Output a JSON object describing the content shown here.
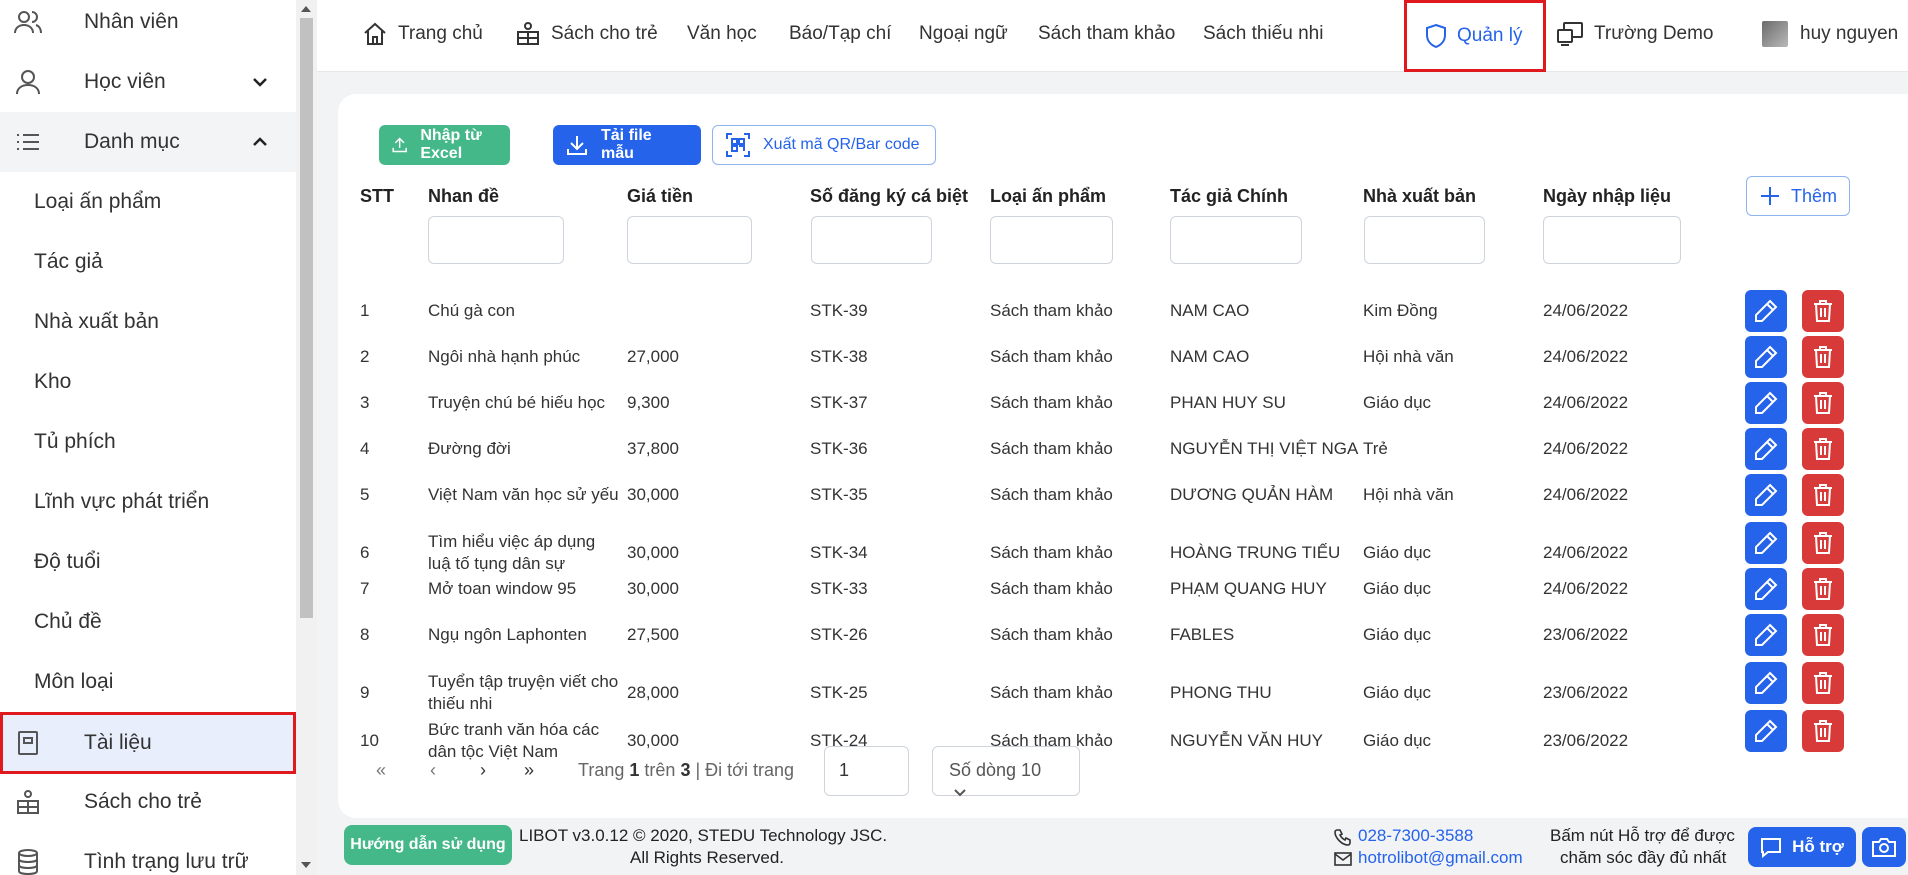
{
  "sidebar": {
    "items": [
      {
        "label": "Nhân viên",
        "icon": "users-icon"
      },
      {
        "label": "Học viên",
        "icon": "user-icon"
      },
      {
        "label": "Danh mục",
        "icon": "list-icon"
      },
      {
        "label": "Loại ấn phẩm"
      },
      {
        "label": "Tác giả"
      },
      {
        "label": "Nhà xuất bản"
      },
      {
        "label": "Kho"
      },
      {
        "label": "Tủ phích"
      },
      {
        "label": "Lĩnh vực phát triển"
      },
      {
        "label": "Độ tuổi"
      },
      {
        "label": "Chủ đề"
      },
      {
        "label": "Môn loại"
      },
      {
        "label": "Tài liệu",
        "icon": "document-icon"
      },
      {
        "label": "Sách cho trẻ",
        "icon": "toy-icon"
      },
      {
        "label": "Tình trạng lưu trữ",
        "icon": "database-icon"
      }
    ]
  },
  "topnav": {
    "home": "Trang chủ",
    "kids_books": "Sách cho trẻ",
    "literature": "Văn học",
    "newspaper": "Báo/Tạp chí",
    "foreign_lang": "Ngoại ngữ",
    "reference": "Sách tham khảo",
    "children": "Sách thiếu nhi",
    "manage": "Quản lý",
    "school": "Trường Demo",
    "user": "huy nguyen"
  },
  "toolbar": {
    "import_excel": "Nhập từ Excel",
    "download_template": "Tải file mẫu",
    "export_qr": "Xuất mã QR/Bar code",
    "add": "Thêm"
  },
  "table": {
    "columns": [
      "STT",
      "Nhan đề",
      "Giá tiền",
      "Số đăng ký cá biệt",
      "Loại ấn phẩm",
      "Tác giả Chính",
      "Nhà xuất bản",
      "Ngày nhập liệu"
    ],
    "rows": [
      {
        "stt": "1",
        "title": "Chú gà con",
        "title2": "",
        "price": "",
        "reg": "STK-39",
        "type": "Sách tham khảo",
        "author": "NAM CAO",
        "publisher": "Kim Đồng",
        "date": "24/06/2022"
      },
      {
        "stt": "2",
        "title": "Ngôi nhà hạnh phúc",
        "title2": "",
        "price": "27,000",
        "reg": "STK-38",
        "type": "Sách tham khảo",
        "author": "NAM CAO",
        "publisher": "Hội nhà văn",
        "date": "24/06/2022"
      },
      {
        "stt": "3",
        "title": "Truyện chú bé hiếu học",
        "title2": "",
        "price": "9,300",
        "reg": "STK-37",
        "type": "Sách tham khảo",
        "author": "PHAN HUY SU",
        "publisher": "Giáo dục",
        "date": "24/06/2022"
      },
      {
        "stt": "4",
        "title": "Đường đời",
        "title2": "",
        "price": "37,800",
        "reg": "STK-36",
        "type": "Sách tham khảo",
        "author": "NGUYỄN THỊ VIỆT NGA",
        "publisher": "Trẻ",
        "date": "24/06/2022"
      },
      {
        "stt": "5",
        "title": "Việt Nam văn học sử yếu",
        "title2": "",
        "price": "30,000",
        "reg": "STK-35",
        "type": "Sách tham khảo",
        "author": "DƯƠNG QUẢN HÀM",
        "publisher": "Hội nhà văn",
        "date": "24/06/2022"
      },
      {
        "stt": "6",
        "title": "Tìm hiểu việc áp dụng",
        "title2": "luậ tố tụng dân sự",
        "price": "30,000",
        "reg": "STK-34",
        "type": "Sách tham khảo",
        "author": "HOÀNG TRUNG TIẾU",
        "publisher": "Giáo dục",
        "date": "24/06/2022"
      },
      {
        "stt": "7",
        "title": "Mở toan window 95",
        "title2": "",
        "price": "30,000",
        "reg": "STK-33",
        "type": "Sách tham khảo",
        "author": "PHẠM QUANG HUY",
        "publisher": "Giáo dục",
        "date": "24/06/2022"
      },
      {
        "stt": "8",
        "title": "Ngụ ngôn Laphonten",
        "title2": "",
        "price": "27,500",
        "reg": "STK-26",
        "type": "Sách tham khảo",
        "author": "FABLES",
        "publisher": "Giáo dục",
        "date": "23/06/2022"
      },
      {
        "stt": "9",
        "title": "Tuyển tập truyện viết cho",
        "title2": "thiếu nhi",
        "price": "28,000",
        "reg": "STK-25",
        "type": "Sách tham khảo",
        "author": "PHONG THU",
        "publisher": "Giáo dục",
        "date": "23/06/2022"
      },
      {
        "stt": "10",
        "title": "Bức tranh văn hóa các",
        "title2": "dân tộc Việt Nam",
        "price": "30,000",
        "reg": "STK-24",
        "type": "Sách tham khảo",
        "author": "NGUYỄN VĂN HUY",
        "publisher": "Giáo dục",
        "date": "23/06/2022"
      }
    ]
  },
  "pagination": {
    "page_prefix": "Trang",
    "current": "1",
    "of": "trên",
    "total": "3",
    "goto": "| Đi tới trang",
    "input_value": "1",
    "rows_select": "Số dòng 10"
  },
  "footer": {
    "guide": "Hướng dẫn sử dụng",
    "copyright1": "LIBOT v3.0.12 © 2020, STEDU Technology JSC.",
    "copyright2": "All Rights Reserved.",
    "phone": "028-7300-3588",
    "email": "hotrolibot@gmail.com",
    "help_text1": "Bấm nút Hỗ trợ để được",
    "help_text2": "chăm sóc đầy đủ nhất",
    "help_button": "Hỗ trợ"
  },
  "colors": {
    "primary": "#2563eb",
    "success": "#45b88a",
    "danger": "#d83a3a",
    "highlight": "#e0191f"
  }
}
